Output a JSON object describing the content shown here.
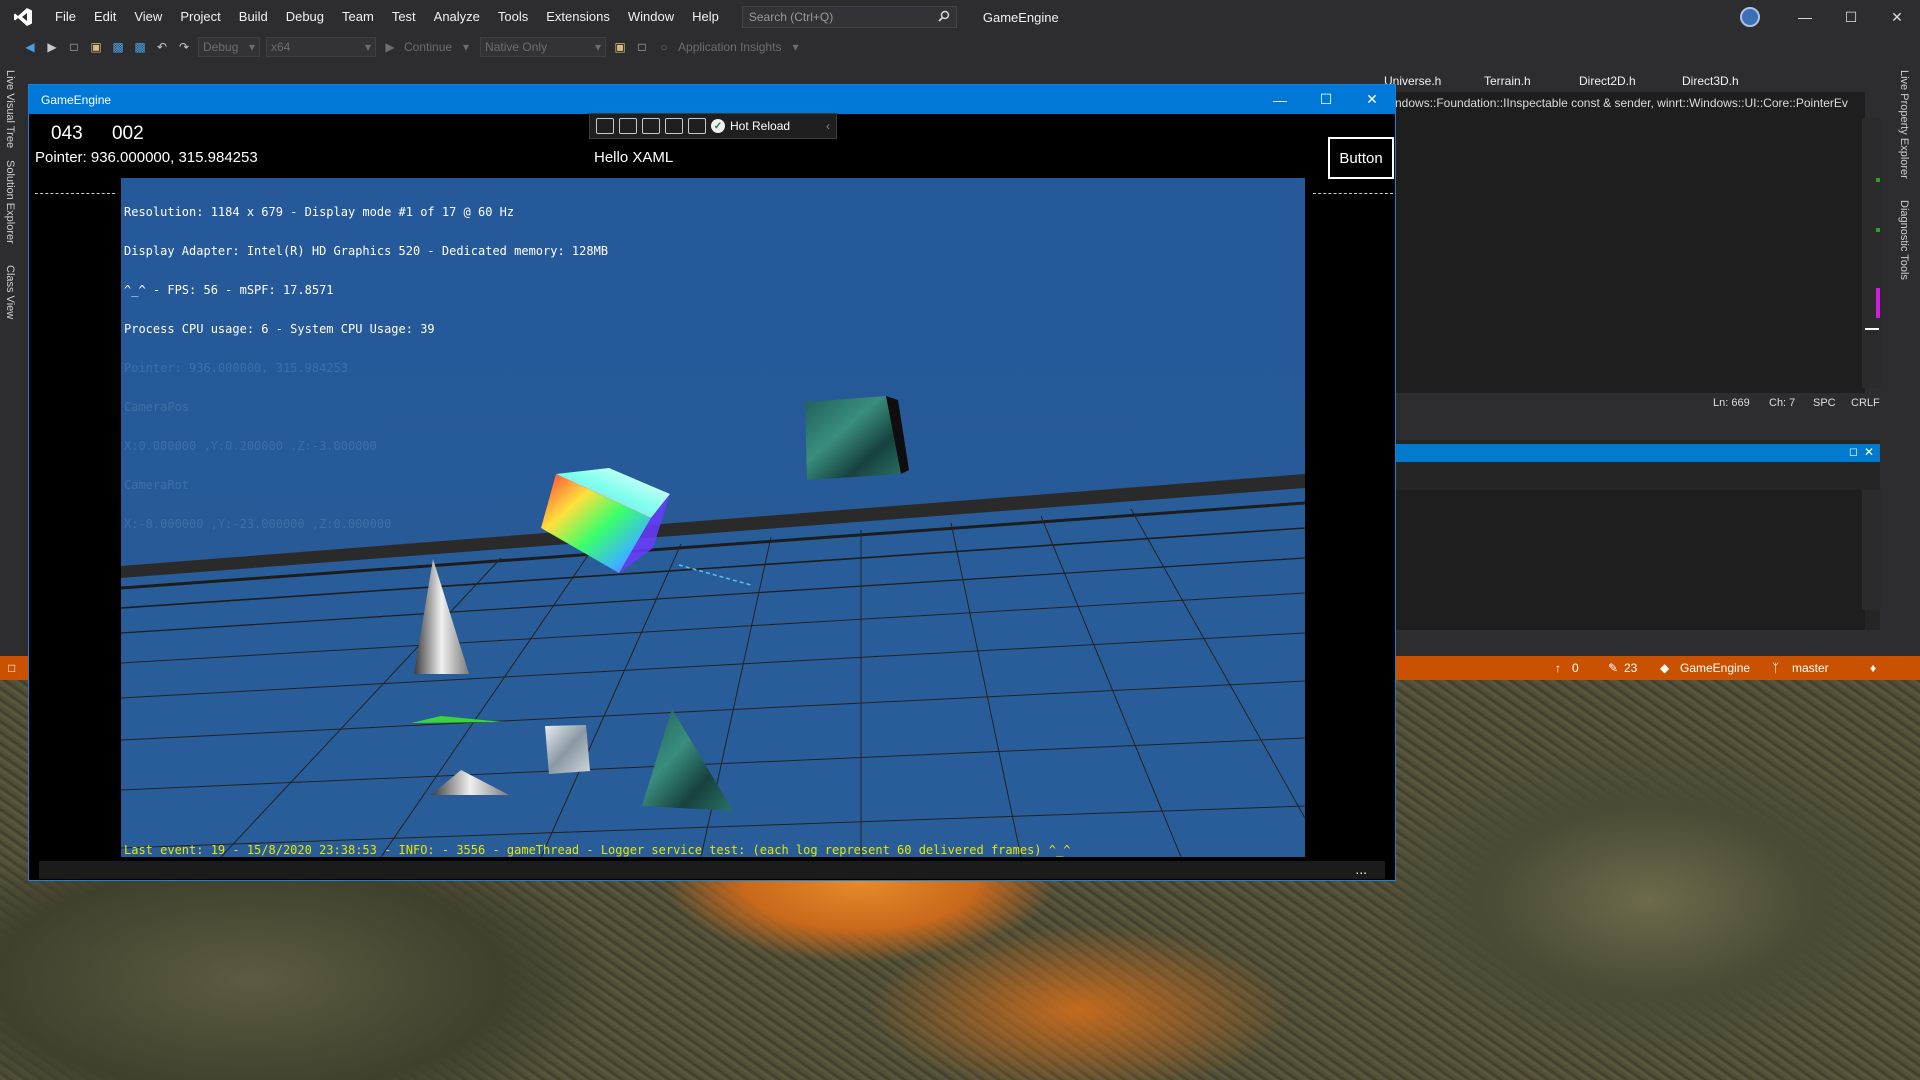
{
  "vs": {
    "menu": [
      "File",
      "Edit",
      "View",
      "Project",
      "Build",
      "Debug",
      "Team",
      "Test",
      "Analyze",
      "Tools",
      "Extensions",
      "Window",
      "Help"
    ],
    "search_placeholder": "Search (Ctrl+Q)",
    "solution_name": "GameEngine",
    "toolbar": {
      "config": "Debug",
      "platform": "x64",
      "continue": "Continue",
      "debugger": "Native Only",
      "app_insights": "Application Insights"
    },
    "left_tabs": [
      "Live Visual Tree",
      "Solution Explorer",
      "Class View"
    ],
    "right_tabs": [
      "Live Property Explorer",
      "Diagnostic Tools"
    ],
    "doc_tabs": [
      "Universe.h",
      "Terrain.h",
      "Direct2D.h",
      "Direct3D.h"
    ],
    "editor_line": "ndows::Foundation::IInspectable const & sender, winrt::Windows::UI::Core::PointerEv",
    "editor_status": {
      "line": "Ln: 669",
      "col": "Ch: 7",
      "spc": "SPC",
      "eol": "CRLF"
    },
    "status_bar": {
      "up_count": "0",
      "pending": "23",
      "repo": "GameEngine",
      "branch": "master"
    }
  },
  "app": {
    "title": "GameEngine",
    "counter_a": "043",
    "counter_b": "002",
    "hot_reload": "Hot Reload",
    "pointer": "Pointer: 936.000000, 315.984253",
    "hello": "Hello XAML",
    "button": "Button",
    "overlay": [
      "Resolution: 1184 x 679 - Display mode #1 of 17 @ 60 Hz",
      "Display Adapter: Intel(R) HD Graphics 520 - Dedicated memory: 128MB",
      "^_^ - FPS: 56 - mSPF: 17.8571",
      "Process CPU usage: 6 - System CPU Usage: 39",
      "Pointer: 936.000000, 315.984253",
      "CameraPos",
      "X:0.000000 ,Y:0.200000 ,Z:-3.000000",
      "CameraRot",
      "X:-8.000000 ,Y:-23.000000 ,Z:0.000000"
    ],
    "log": "Last event: 19 - 15/8/2020 23:38:53 - INFO: - 3556 - gameThread - Logger service test: (each log represent 60 delivered frames) ^_^",
    "more": "..."
  },
  "colors": {
    "accent": "#0078d7",
    "status_bar": "#ca5100",
    "scene_bg": "#27599a",
    "log_text": "#e6e600"
  }
}
